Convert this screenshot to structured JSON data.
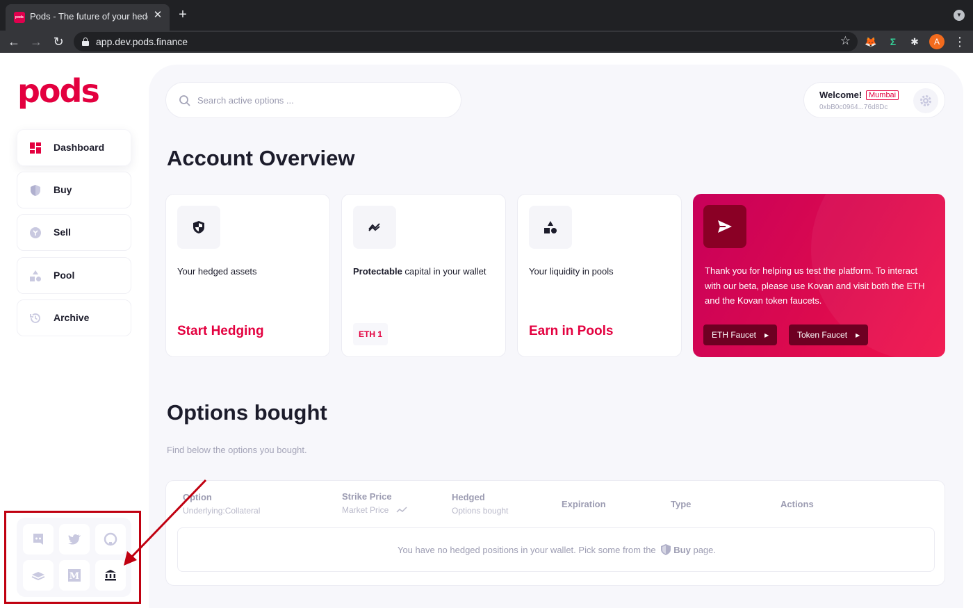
{
  "browser": {
    "tab_title": "Pods - The future of your hedging",
    "favicon_text": "pods",
    "url": "app.dev.pods.finance",
    "profile_initial": "A"
  },
  "brand": {
    "logo": "pods",
    "accent": "#e3003f"
  },
  "sidebar": {
    "items": [
      {
        "label": "Dashboard",
        "icon": "dashboard-icon",
        "active": true
      },
      {
        "label": "Buy",
        "icon": "shield-icon"
      },
      {
        "label": "Sell",
        "icon": "coin-icon"
      },
      {
        "label": "Pool",
        "icon": "shapes-icon"
      },
      {
        "label": "Archive",
        "icon": "history-icon"
      }
    ],
    "social": [
      "discord-icon",
      "twitter-icon",
      "github-icon",
      "docs-icon",
      "medium-icon",
      "bank-icon"
    ]
  },
  "header": {
    "search_placeholder": "Search active options ...",
    "welcome": "Welcome!",
    "network": "Mumbai",
    "address": "0xbB0c0964...76d8Dc"
  },
  "overview": {
    "title": "Account Overview",
    "cards": [
      {
        "pre": "",
        "text": "Your hedged assets",
        "cta": "Start Hedging"
      },
      {
        "pre": "Protectable",
        "text": " capital in your wallet",
        "badge": "ETH 1"
      },
      {
        "pre": "",
        "text": "Your liquidity in pools",
        "cta": "Earn in Pools"
      }
    ],
    "promo": {
      "text": "Thank you for helping us test the platform. To interact with our beta, please use Kovan and visit both the ETH and the Kovan token faucets.",
      "eth_faucet": "ETH Faucet",
      "token_faucet": "Token Faucet"
    }
  },
  "options": {
    "title": "Options bought",
    "subtitle": "Find below the options you bought.",
    "columns": [
      {
        "label": "Option",
        "sub": "Underlying:Collateral"
      },
      {
        "label": "Strike Price",
        "sub": "Market Price"
      },
      {
        "label": "Hedged",
        "sub": "Options bought"
      },
      {
        "label": "Expiration",
        "sub": ""
      },
      {
        "label": "Type",
        "sub": ""
      },
      {
        "label": "Actions",
        "sub": ""
      }
    ],
    "empty_pre": "You have no hedged positions in your wallet. Pick some from the",
    "empty_link": "Buy",
    "empty_post": "page."
  }
}
